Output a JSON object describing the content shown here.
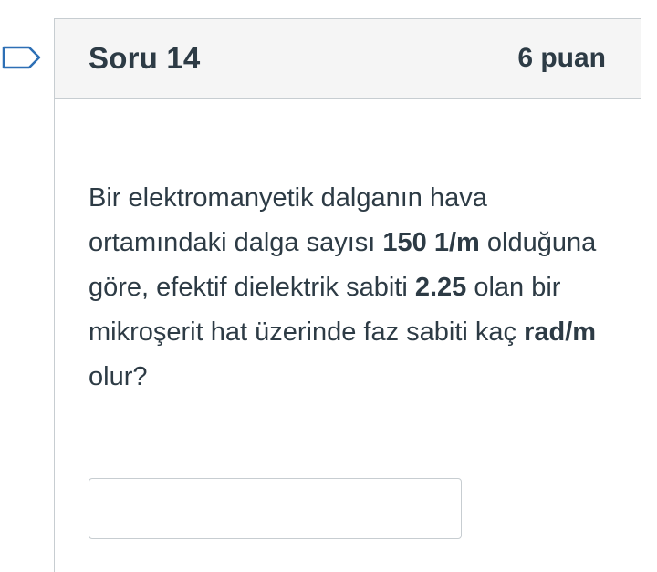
{
  "question": {
    "title": "Soru 14",
    "points": "6 puan",
    "text_parts": {
      "p1": "Bir elektromanyetik dalganın hava ortamındaki dalga sayısı ",
      "b1": "150 1/m",
      "p2": " olduğuna göre, efektif dielektrik sabiti ",
      "b2": "2.25",
      "p3": " olan bir mikroşerit hat üzerinde faz sabiti kaç ",
      "b3": "rad/m",
      "p4": " olur?"
    },
    "answer": {
      "value": "",
      "placeholder": ""
    }
  },
  "colors": {
    "text": "#2d3b45",
    "header_bg": "#f5f5f5",
    "border": "#c7cdd1",
    "flag_stroke": "#2d6fb5"
  },
  "icons": {
    "flag": "bookmark-flag-icon"
  }
}
